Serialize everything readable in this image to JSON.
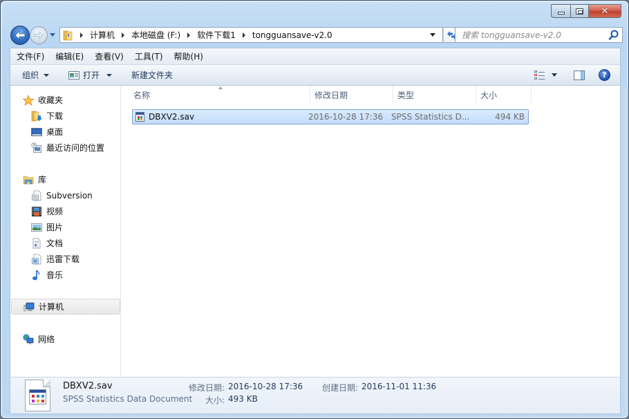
{
  "window": {
    "caption_buttons": {
      "minimize": "minimize",
      "maximize": "maximize",
      "close": "close"
    }
  },
  "navigation": {
    "back_icon": "back-arrow-icon",
    "forward_icon": "forward-arrow-icon",
    "breadcrumbs": [
      "计算机",
      "本地磁盘 (F:)",
      "软件下载1",
      "tongguansave-v2.0"
    ],
    "search_placeholder": "搜索 tongguansave-v2.0"
  },
  "menu": {
    "items": [
      "文件(F)",
      "编辑(E)",
      "查看(V)",
      "工具(T)",
      "帮助(H)"
    ]
  },
  "toolbar": {
    "organize_label": "组织",
    "open_label": "打开",
    "new_folder_label": "新建文件夹",
    "help_glyph": "?"
  },
  "sidebar": {
    "favorites": {
      "label": "收藏夹",
      "items": [
        "下载",
        "桌面",
        "最近访问的位置"
      ]
    },
    "libraries": {
      "label": "库",
      "items": [
        "Subversion",
        "视频",
        "图片",
        "文档",
        "迅雷下载",
        "音乐"
      ]
    },
    "computer": {
      "label": "计算机"
    },
    "network": {
      "label": "网络"
    }
  },
  "file_list": {
    "columns": [
      "名称",
      "修改日期",
      "类型",
      "大小"
    ],
    "rows": [
      {
        "name": "DBXV2.sav",
        "modified": "2016-10-28 17:36",
        "type": "SPSS Statistics D...",
        "size": "494 KB"
      }
    ]
  },
  "details": {
    "file_name": "DBXV2.sav",
    "file_type": "SPSS Statistics Data Document",
    "modified_label": "修改日期:",
    "modified_value": "2016-10-28 17:36",
    "created_label": "创建日期:",
    "created_value": "2016-11-01 11:36",
    "size_label": "大小:",
    "size_value": "493 KB"
  },
  "colors": {
    "accent": "#1e395b",
    "selection": "#c1dcfc",
    "close_button": "#c0402e"
  }
}
